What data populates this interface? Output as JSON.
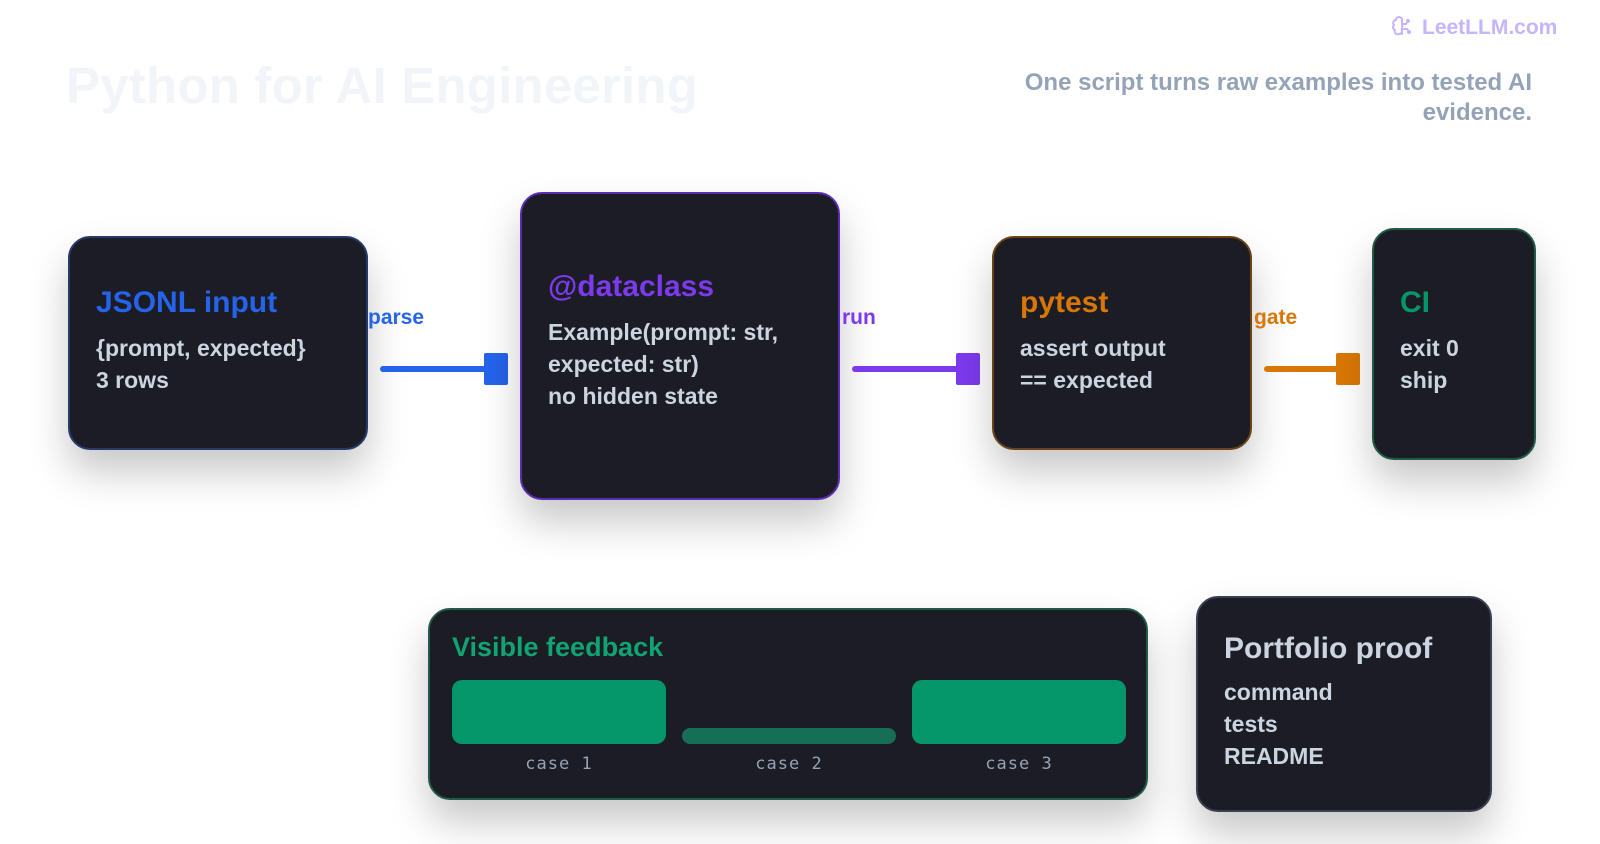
{
  "brand": {
    "name": "LeetLLM.com",
    "icon": "brain-icon"
  },
  "header": {
    "title": "Python for AI Engineering",
    "subtitle": "One script turns raw examples into tested AI evidence."
  },
  "colors": {
    "parse": "#2563eb",
    "run": "#7c3aed",
    "gate": "#d97706",
    "ci": "#059669",
    "card_bg": "#1c1c24"
  },
  "pipeline": {
    "jsonl": {
      "title": "JSONL input",
      "lines": [
        "{prompt, expected}",
        "3 rows"
      ]
    },
    "dataclass": {
      "title": "@dataclass",
      "lines": [
        "Example(prompt: str,",
        "expected: str)",
        "no hidden state"
      ]
    },
    "pytest": {
      "title": "pytest",
      "lines": [
        "assert output",
        "== expected"
      ]
    },
    "ci": {
      "title": "CI",
      "lines": [
        "exit 0",
        "ship"
      ]
    }
  },
  "edges": {
    "parse": "parse",
    "run": "run",
    "gate": "gate"
  },
  "feedback": {
    "title": "Visible feedback",
    "cases": [
      {
        "label": "case 1",
        "status": "pass"
      },
      {
        "label": "case 2",
        "status": "fail"
      },
      {
        "label": "case 3",
        "status": "pass"
      }
    ]
  },
  "portfolio": {
    "title": "Portfolio proof",
    "lines": [
      "command",
      "tests",
      "README"
    ]
  }
}
